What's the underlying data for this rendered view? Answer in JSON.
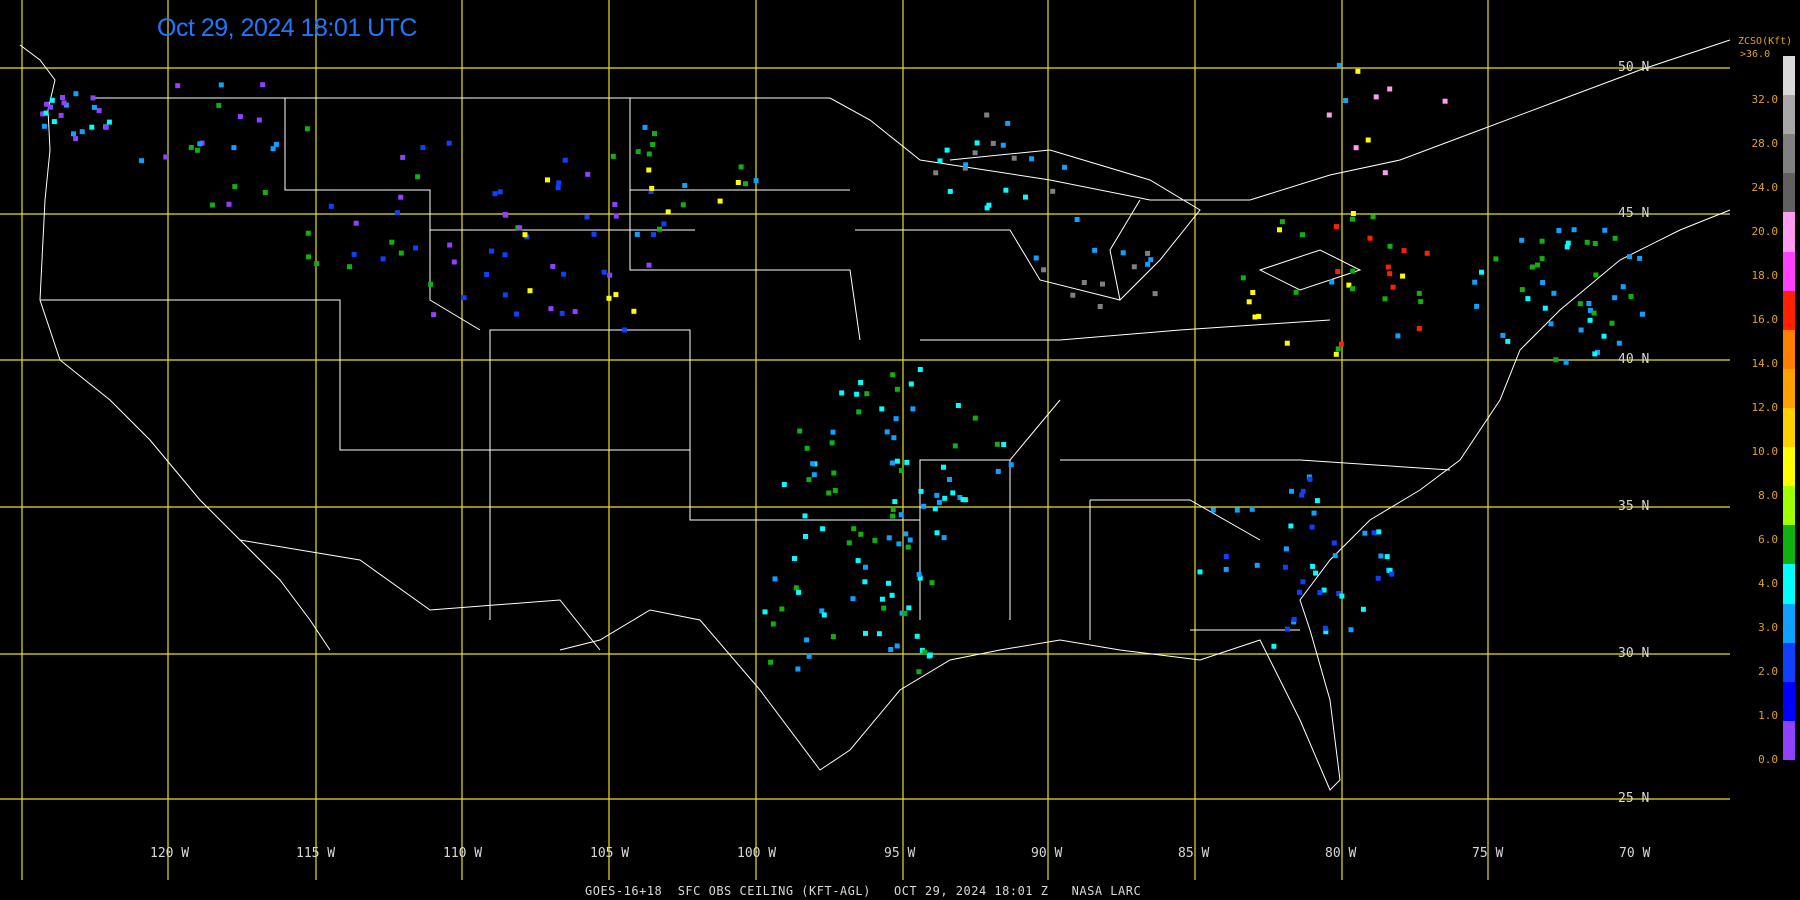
{
  "title": "Oct 29, 2024 18:01 UTC",
  "footer": "GOES-16+18  SFC OBS CEILING (KFT-AGL)   OCT 29, 2024 18:01 Z   NASA LARC",
  "legend": {
    "title": "ZCSO(Kft)",
    "top_label": ">36.0",
    "labels": [
      "32.0",
      "28.0",
      "24.0",
      "20.0",
      "18.0",
      "16.0",
      "14.0",
      "12.0",
      "10.0",
      "8.0",
      "6.0",
      "4.0",
      "3.0",
      "2.0",
      "1.0",
      "0.0"
    ],
    "colors": [
      "#d8d8d8",
      "#a8a8a8",
      "#808080",
      "#606060",
      "#ff9cf0",
      "#ff40ff",
      "#ff2000",
      "#ff8000",
      "#ffa000",
      "#ffd000",
      "#ffff00",
      "#a0ff00",
      "#10b010",
      "#00ffff",
      "#10a0ff",
      "#1040ff",
      "#0000ff",
      "#9040ff"
    ]
  },
  "lat_labels": [
    "50 N",
    "45 N",
    "40 N",
    "35 N",
    "30 N",
    "25 N"
  ],
  "lon_labels": [
    "120 W",
    "115 W",
    "110 W",
    "105 W",
    "100 W",
    "95 W",
    "90 W",
    "85 W",
    "80 W",
    "75 W",
    "70 W"
  ],
  "colors": {
    "grid": "#e8e020",
    "coast": "#ffffff",
    "timestamp": "#1e78ff"
  }
}
